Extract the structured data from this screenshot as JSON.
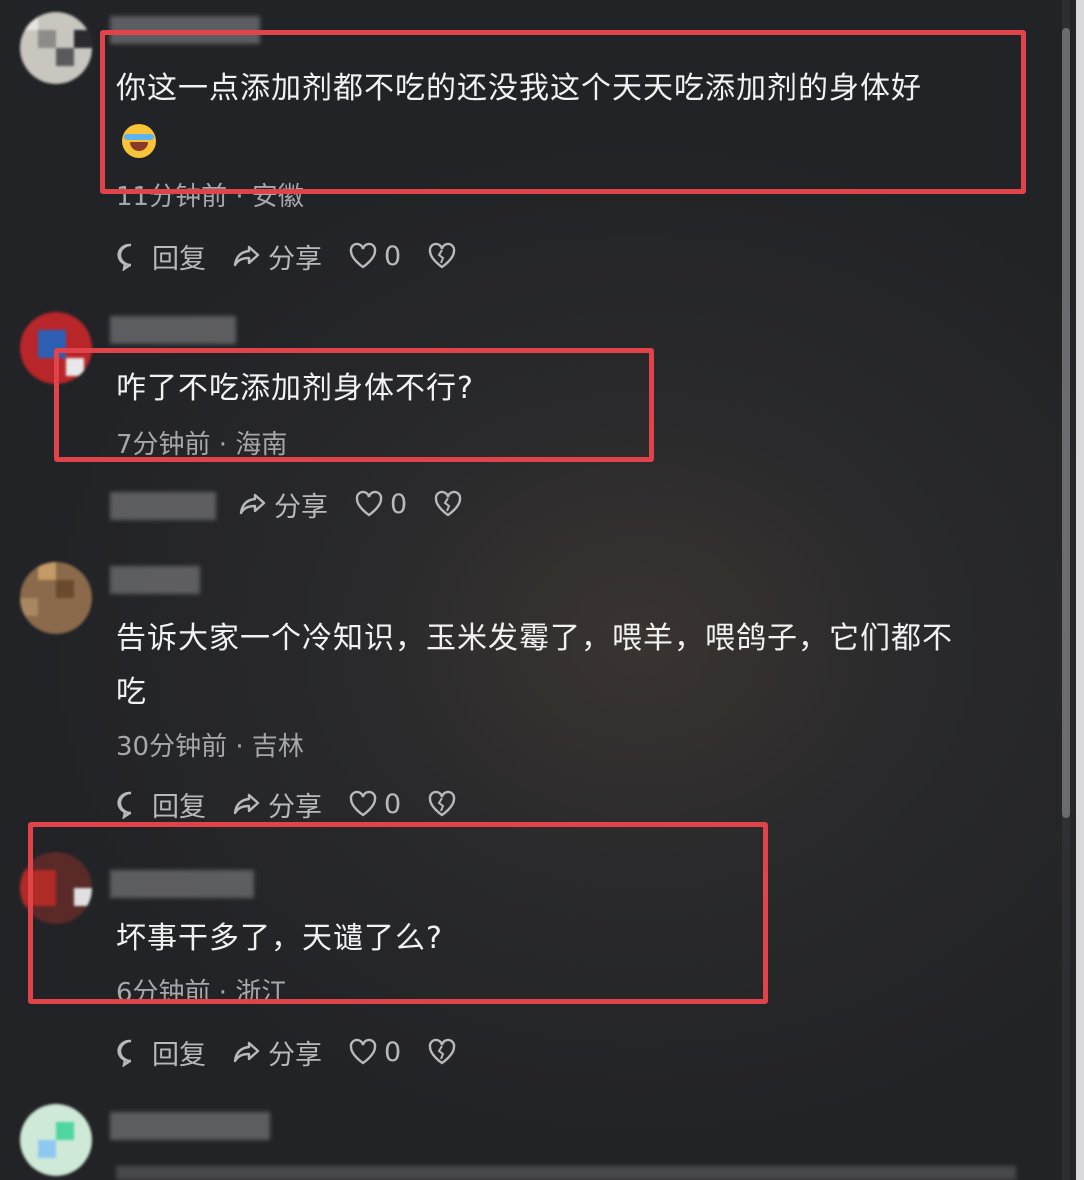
{
  "comments": [
    {
      "text_line1": "你这一点添加剂都不吃的还没我这个天天吃添加剂的身体好",
      "emoji": "cry-laugh-emoji",
      "meta": "11分钟前 · 安徽",
      "reply": "回复",
      "share": "分享",
      "likes": "0"
    },
    {
      "text_line1": "咋了不吃添加剂身体不行?",
      "meta": "7分钟前 · 海南",
      "share": "分享",
      "likes": "0"
    },
    {
      "text_line1": "告诉大家一个冷知识，玉米发霉了，喂羊，喂鸽子，它们都不",
      "text_line2": "吃",
      "meta": "30分钟前 · 吉林",
      "reply": "回复",
      "share": "分享",
      "likes": "0"
    },
    {
      "text_line1": "坏事干多了，天谴了么?",
      "meta": "6分钟前 · 浙江",
      "reply": "回复",
      "share": "分享",
      "likes": "0"
    }
  ],
  "colors": {
    "highlight": "#e0434a",
    "background": "#26262a"
  },
  "icons": [
    "comment-bubble-icon",
    "share-arrow-icon",
    "heart-icon",
    "broken-heart-icon"
  ]
}
